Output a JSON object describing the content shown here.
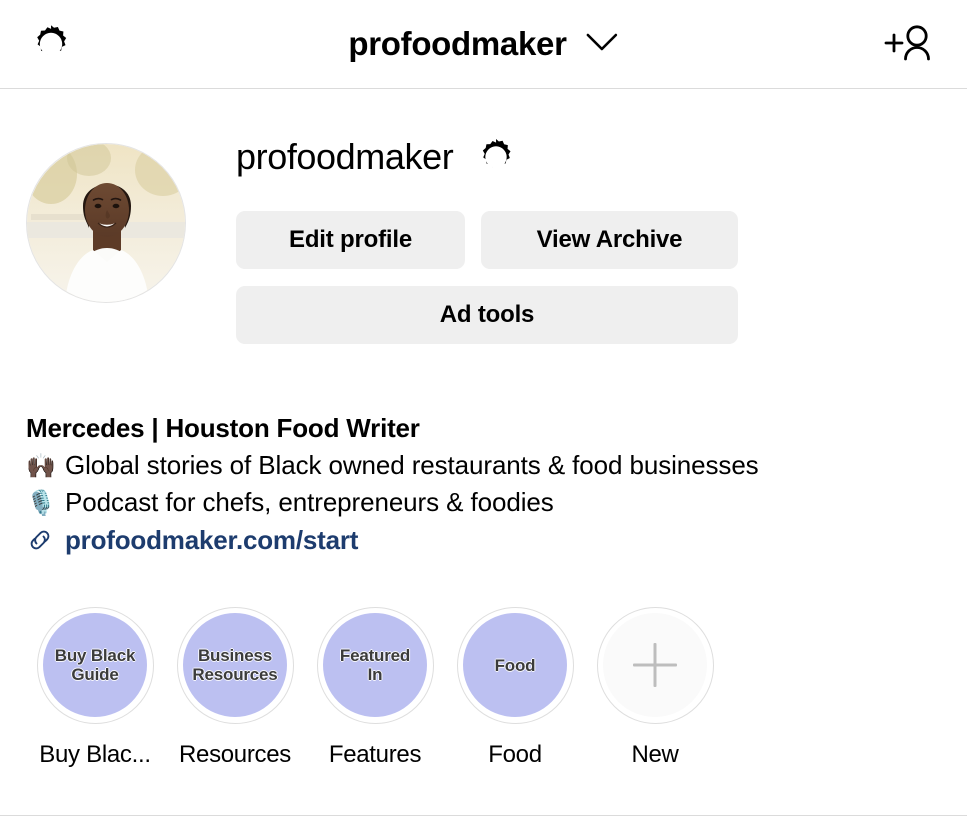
{
  "topbar": {
    "left_icon": "gear-icon",
    "username": "profoodmaker",
    "dropdown_icon": "chevron-down-icon",
    "right_icon": "add-person-icon"
  },
  "profile": {
    "username": "profoodmaker",
    "verified_icon": "gear-icon",
    "avatar_alt": "profile-photo",
    "buttons": {
      "edit_profile": "Edit profile",
      "view_archive": "View Archive",
      "ad_tools": "Ad tools"
    }
  },
  "bio": {
    "display_name": "Mercedes | Houston Food Writer",
    "lines": [
      {
        "emoji": "🙌🏿",
        "emoji_name": "raised-hands-icon",
        "text": "Global stories of Black owned restaurants & food businesses"
      },
      {
        "emoji": "🎙️",
        "emoji_name": "studio-microphone-icon",
        "text": "Podcast for chefs, entrepreneurs & foodies"
      }
    ],
    "link_icon": "link-icon",
    "link_text": "profoodmaker.com/start",
    "link_color": "#1d3c6e"
  },
  "highlights": {
    "cover_color": "#bcc0f1",
    "new_color": "#fafafa",
    "items": [
      {
        "cover_text": "Buy Black\nGuide",
        "label": "Buy Blac...",
        "type": "cover"
      },
      {
        "cover_text": "Business\nResources",
        "label": "Resources",
        "type": "cover"
      },
      {
        "cover_text": "Featured\nIn",
        "label": "Features",
        "type": "cover"
      },
      {
        "cover_text": "Food",
        "label": "Food",
        "type": "cover"
      },
      {
        "cover_text": "",
        "label": "New",
        "type": "new"
      }
    ]
  }
}
